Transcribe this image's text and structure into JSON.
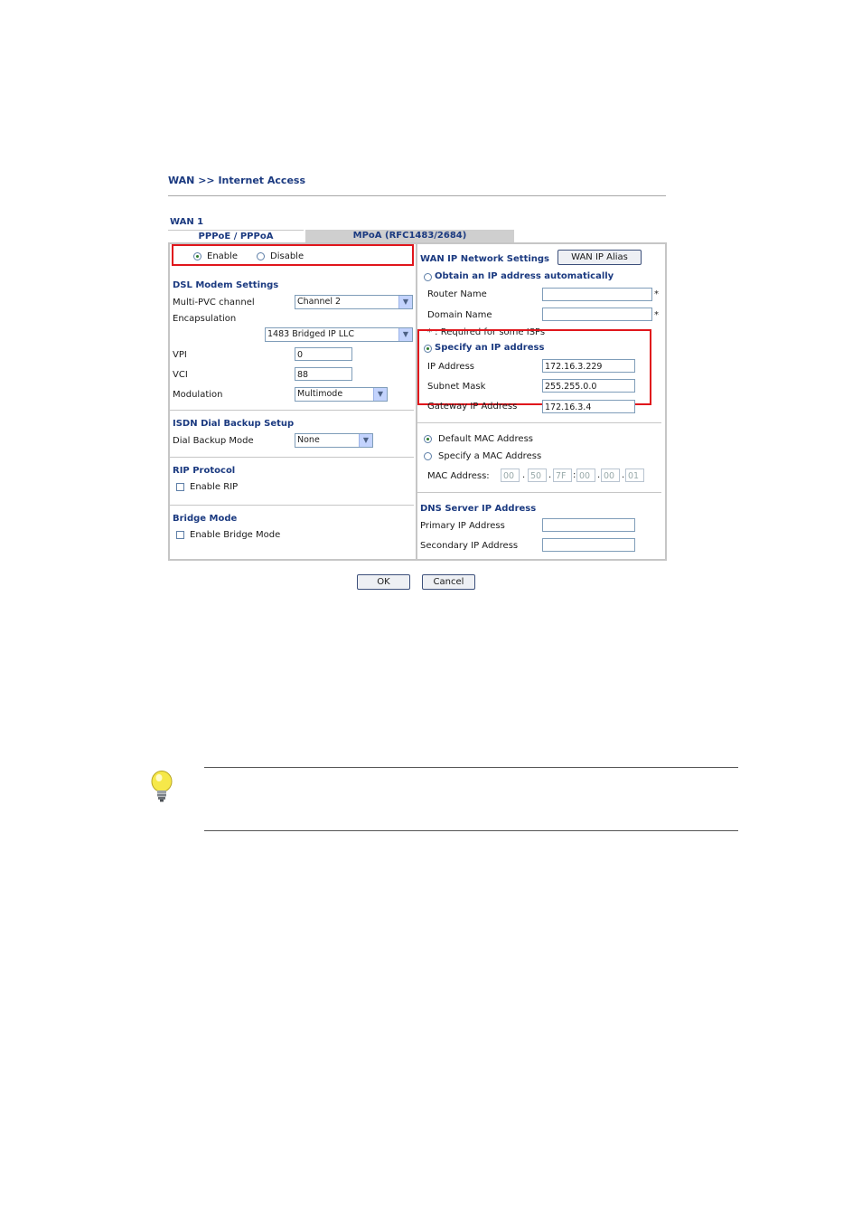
{
  "breadcrumb": "WAN >> Internet Access",
  "wan_label": "WAN 1",
  "tabs": [
    {
      "label": "PPPoE / PPPoA"
    },
    {
      "label": "MPoA (RFC1483/2684)"
    }
  ],
  "enable_group": {
    "enable": "Enable",
    "disable": "Disable",
    "selected": "Enable"
  },
  "dsl": {
    "title": "DSL Modem Settings",
    "multipvc_label": "Multi-PVC channel",
    "multipvc_value": "Channel 2",
    "encapsulation_label": "Encapsulation",
    "encapsulation_value": "1483 Bridged IP LLC",
    "vpi_label": "VPI",
    "vpi_value": "0",
    "vci_label": "VCI",
    "vci_value": "88",
    "modulation_label": "Modulation",
    "modulation_value": "Multimode"
  },
  "isdn": {
    "title": "ISDN Dial Backup Setup",
    "mode_label": "Dial Backup Mode",
    "mode_value": "None"
  },
  "rip": {
    "title": "RIP Protocol",
    "enable_label": "Enable RIP"
  },
  "bridge": {
    "title": "Bridge Mode",
    "enable_label": "Enable Bridge Mode"
  },
  "wanip": {
    "title": "WAN IP Network Settings",
    "alias_button": "WAN IP Alias",
    "obtain_label": "Obtain an IP address automatically",
    "router_name_label": "Router Name",
    "router_name_value": "",
    "domain_name_label": "Domain Name",
    "domain_name_value": "",
    "required_note": "* : Required for some ISPs",
    "star": "*",
    "specify_label": "Specify an IP address",
    "ip_label": "IP Address",
    "ip_value": "172.16.3.229",
    "mask_label": "Subnet Mask",
    "mask_value": "255.255.0.0",
    "gateway_label": "Gateway IP Address",
    "gateway_value": "172.16.3.4"
  },
  "mac": {
    "default_label": "Default MAC Address",
    "specify_label": "Specify a MAC Address",
    "address_label": "MAC Address:",
    "octets": [
      "00",
      "50",
      "7F",
      "00",
      "00",
      "01"
    ]
  },
  "dns": {
    "title": "DNS Server IP Address",
    "primary_label": "Primary IP Address",
    "primary_value": "",
    "secondary_label": "Secondary IP Address",
    "secondary_value": ""
  },
  "buttons": {
    "ok": "OK",
    "cancel": "Cancel"
  }
}
